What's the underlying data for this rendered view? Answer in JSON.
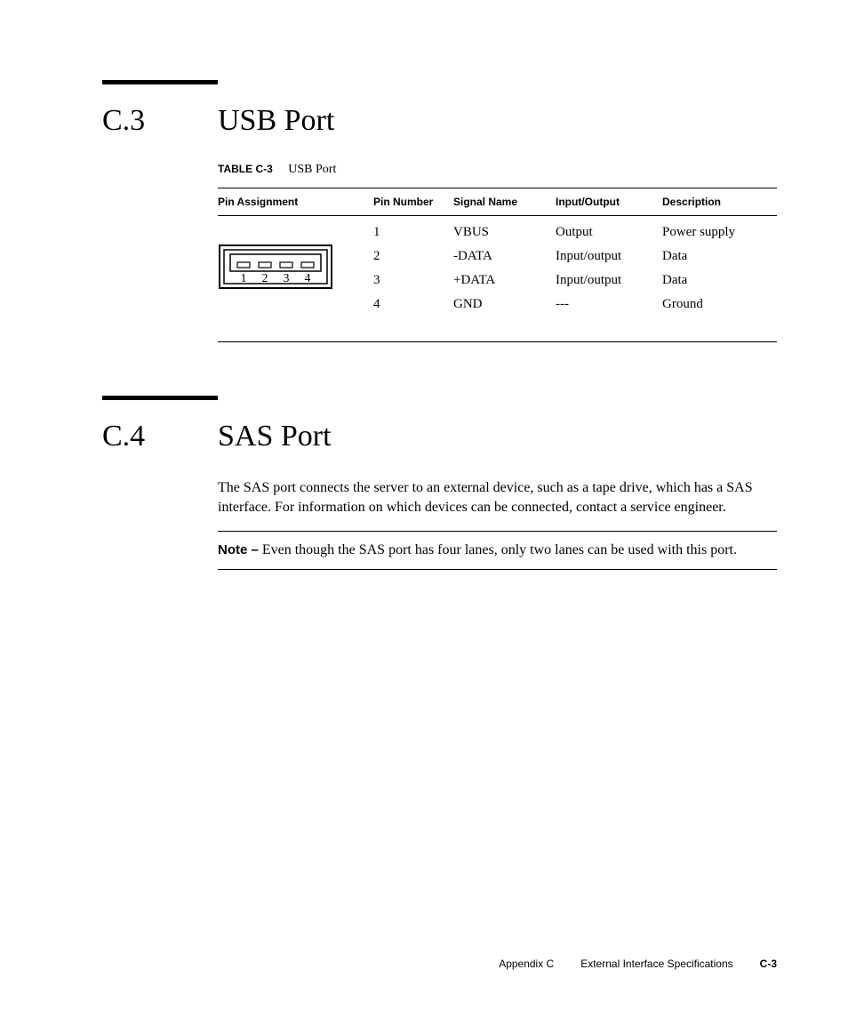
{
  "section1": {
    "num": "C.3",
    "title": "USB Port",
    "table_label": "TABLE C-3",
    "table_title": "USB Port",
    "headers": {
      "pin_assignment": "Pin Assignment",
      "pin_number": "Pin Number",
      "signal_name": "Signal Name",
      "input_output": "Input/Output",
      "description": "Description"
    },
    "rows": [
      {
        "pin_number": "1",
        "signal": "VBUS",
        "io": "Output",
        "desc": "Power supply"
      },
      {
        "pin_number": "2",
        "signal": "-DATA",
        "io": "Input/output",
        "desc": "Data"
      },
      {
        "pin_number": "3",
        "signal": "+DATA",
        "io": "Input/output",
        "desc": "Data"
      },
      {
        "pin_number": "4",
        "signal": "GND",
        "io": "---",
        "desc": "Ground"
      }
    ],
    "diagram_labels": [
      "1",
      "2",
      "3",
      "4"
    ]
  },
  "section2": {
    "num": "C.4",
    "title": "SAS Port",
    "body": "The SAS port connects the server to an external device, such as a tape drive, which has a SAS interface.  For information on which devices can be connected, contact a service engineer.",
    "note_label": "Note –",
    "note_text": " Even though the SAS port has four lanes, only two lanes can be used with this port."
  },
  "footer": {
    "appendix": "Appendix C",
    "title": "External Interface Specifications",
    "page": "C-3"
  }
}
